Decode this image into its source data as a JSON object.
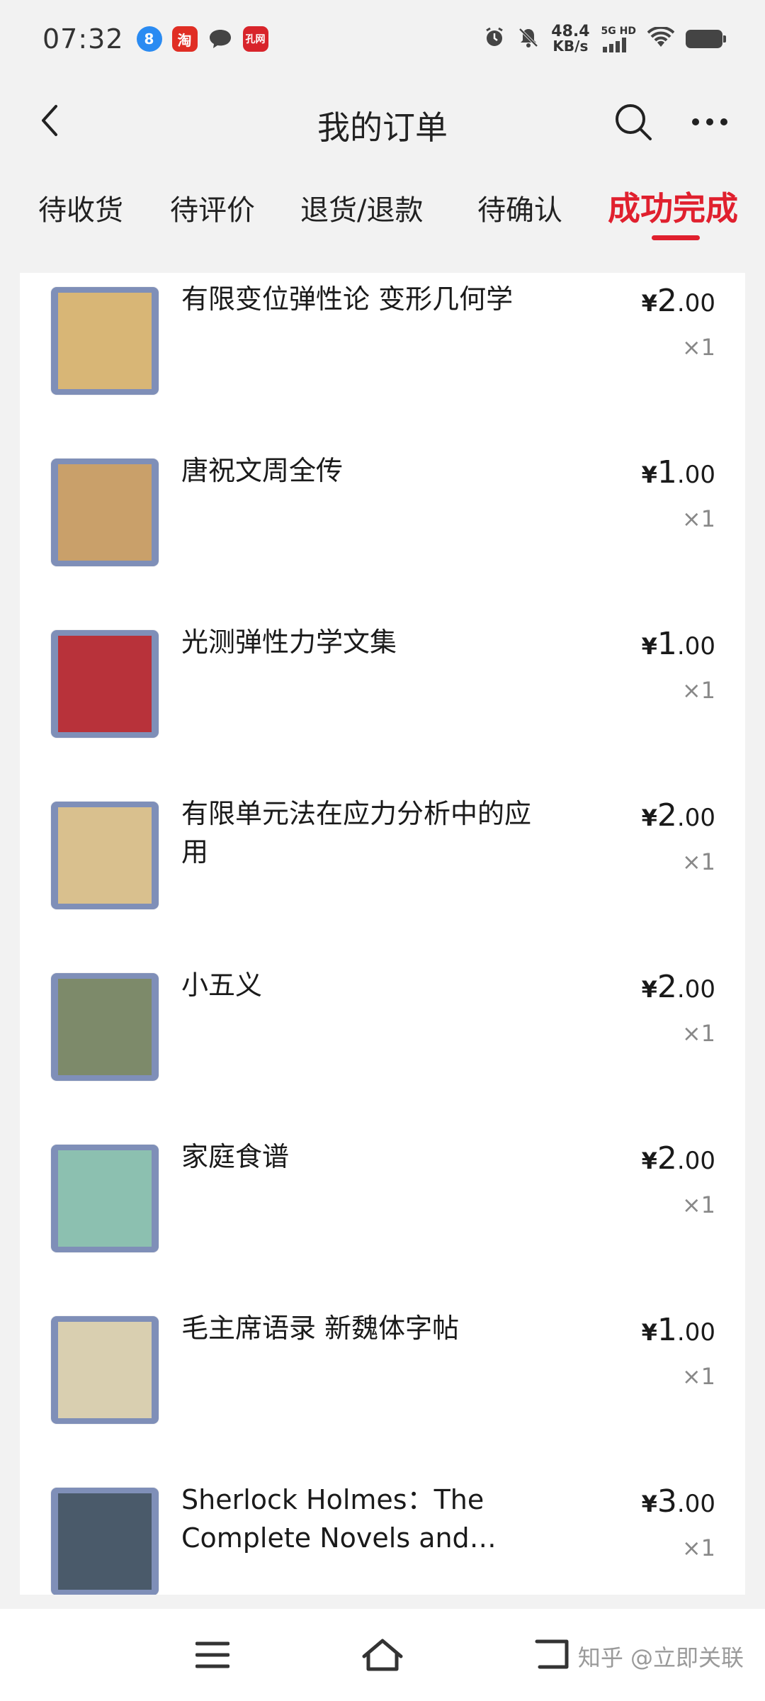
{
  "status_bar": {
    "time": "07:32",
    "net_speed_value": "48.4",
    "net_speed_unit": "KB/s",
    "signal_label": "5G HD",
    "app_badge_blue": "8",
    "app_badge_taobao": "淘",
    "app_badge_kongfz": "孔网"
  },
  "header": {
    "title": "我的订单"
  },
  "tabs": [
    {
      "label": "待收货"
    },
    {
      "label": "待评价"
    },
    {
      "label": "退货/退款"
    },
    {
      "label": "待确认"
    },
    {
      "label": "成功完成",
      "active": true
    }
  ],
  "orders": [
    {
      "title": "有限变位弹性论 变形几何学",
      "currency": "¥",
      "price_int": "2",
      "price_dec": ".00",
      "qty": "×1",
      "cover_color": "#d8b676"
    },
    {
      "title": "唐祝文周全传",
      "currency": "¥",
      "price_int": "1",
      "price_dec": ".00",
      "qty": "×1",
      "cover_color": "#c9a06a"
    },
    {
      "title": "光测弹性力学文集",
      "currency": "¥",
      "price_int": "1",
      "price_dec": ".00",
      "qty": "×1",
      "cover_color": "#b8323a"
    },
    {
      "title": "有限单元法在应力分析中的应用",
      "currency": "¥",
      "price_int": "2",
      "price_dec": ".00",
      "qty": "×1",
      "cover_color": "#d9c08e"
    },
    {
      "title": "小五义",
      "currency": "¥",
      "price_int": "2",
      "price_dec": ".00",
      "qty": "×1",
      "cover_color": "#7d8a6a"
    },
    {
      "title": "家庭食谱",
      "currency": "¥",
      "price_int": "2",
      "price_dec": ".00",
      "qty": "×1",
      "cover_color": "#8cc0b0"
    },
    {
      "title": "毛主席语录 新魏体字帖",
      "currency": "¥",
      "price_int": "1",
      "price_dec": ".00",
      "qty": "×1",
      "cover_color": "#d9cfb0"
    },
    {
      "title": "Sherlock Holmes：The Complete Novels and Stori…",
      "currency": "¥",
      "price_int": "3",
      "price_dec": ".00",
      "qty": "×1",
      "cover_color": "#4a5a6a"
    }
  ],
  "watermark": "知乎 @立即关联",
  "colors": {
    "accent": "#e0202e",
    "background": "#f2f2f2"
  }
}
